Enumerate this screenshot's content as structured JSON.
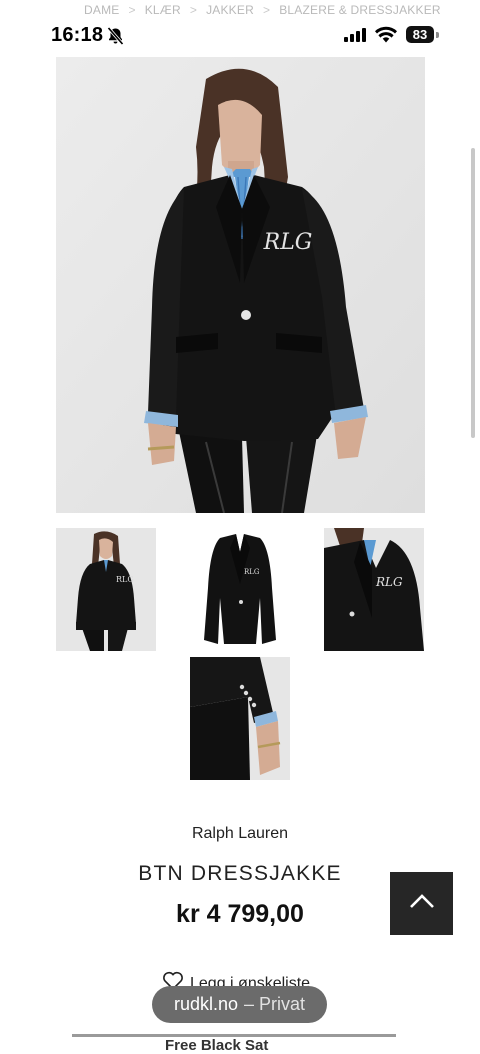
{
  "breadcrumb": {
    "items": [
      "DAME",
      "KLÆR",
      "JAKKER",
      "BLAZERE & DRESSJAKKER"
    ],
    "separator": ">"
  },
  "status_bar": {
    "time": "16:18",
    "battery": "83",
    "icons": [
      "bell-slash-icon",
      "signal-icon",
      "wifi-icon",
      "battery-icon"
    ]
  },
  "product": {
    "brand": "Ralph Lauren",
    "name": "BTN DRESSJAKKE",
    "price": "kr 4 799,00",
    "monogram": "RLG",
    "images": [
      {
        "name": "main-image",
        "alt": "Model wearing black blazer"
      },
      {
        "name": "thumbnail-1",
        "alt": "Model front view"
      },
      {
        "name": "thumbnail-2",
        "alt": "Blazer flat lay"
      },
      {
        "name": "thumbnail-3",
        "alt": "Crest close-up"
      },
      {
        "name": "thumbnail-4",
        "alt": "Sleeve buttons detail"
      }
    ]
  },
  "wishlist": {
    "label": "Legg i ønskeliste",
    "icon": "heart-icon"
  },
  "browser_pill": {
    "domain": "rudkl.no",
    "mode": "– Privat"
  },
  "footer_partial": "Free Black Sat",
  "colors": {
    "background": "#ffffff",
    "text": "#222222",
    "back_to_top": "#262626",
    "pill": "#6b6b6b",
    "breadcrumb": "#b9b9b9"
  }
}
